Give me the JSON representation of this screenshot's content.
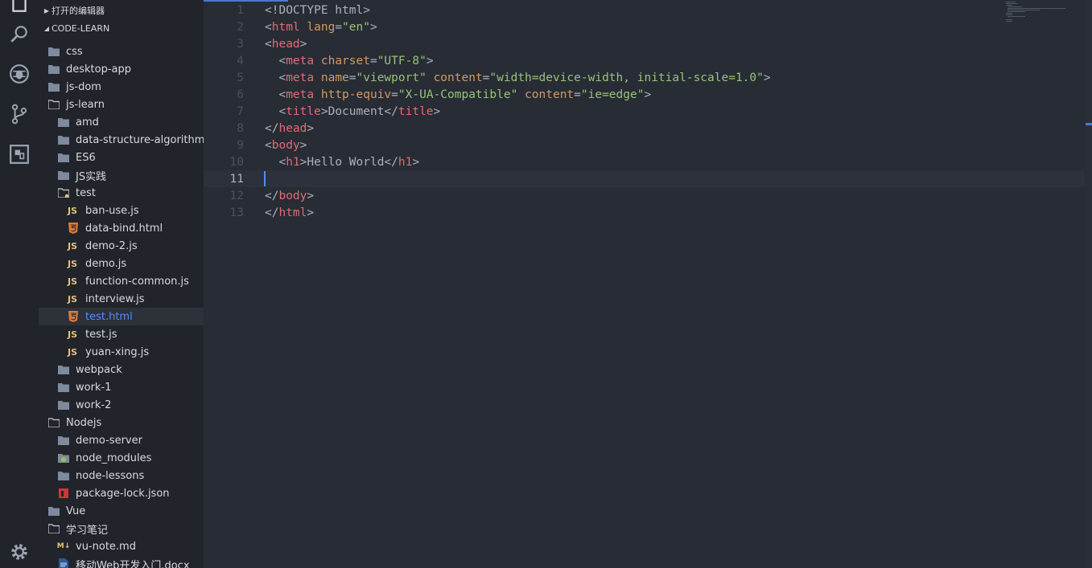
{
  "activity_bar": {
    "icons": [
      "explorer-icon",
      "search-icon",
      "debug-icon",
      "source-control-icon",
      "extensions-icon",
      "settings-gear-icon"
    ]
  },
  "sidebar": {
    "open_editors_label": "打开的编辑器",
    "project_label": "CODE-LEARN",
    "tree": [
      {
        "name": "css",
        "type": "folder",
        "depth": 0
      },
      {
        "name": "desktop-app",
        "type": "folder",
        "depth": 0
      },
      {
        "name": "js-dom",
        "type": "folder",
        "depth": 0
      },
      {
        "name": "js-learn",
        "type": "folder-open",
        "depth": 0
      },
      {
        "name": "amd",
        "type": "folder",
        "depth": 1
      },
      {
        "name": "data-structure-algorithm",
        "type": "folder",
        "depth": 1
      },
      {
        "name": "ES6",
        "type": "folder",
        "depth": 1
      },
      {
        "name": "JS实践",
        "type": "folder",
        "depth": 1
      },
      {
        "name": "test",
        "type": "folder-open",
        "depth": 1
      },
      {
        "name": "ban-use.js",
        "type": "js",
        "depth": 2
      },
      {
        "name": "data-bind.html",
        "type": "html",
        "depth": 2
      },
      {
        "name": "demo-2.js",
        "type": "js",
        "depth": 2
      },
      {
        "name": "demo.js",
        "type": "js",
        "depth": 2
      },
      {
        "name": "function-common.js",
        "type": "js",
        "depth": 2
      },
      {
        "name": "interview.js",
        "type": "js",
        "depth": 2
      },
      {
        "name": "test.html",
        "type": "html",
        "depth": 2,
        "selected": true
      },
      {
        "name": "test.js",
        "type": "js",
        "depth": 2
      },
      {
        "name": "yuan-xing.js",
        "type": "js",
        "depth": 2
      },
      {
        "name": "webpack",
        "type": "folder",
        "depth": 1
      },
      {
        "name": "work-1",
        "type": "folder",
        "depth": 1
      },
      {
        "name": "work-2",
        "type": "folder",
        "depth": 1
      },
      {
        "name": "Nodejs",
        "type": "folder-open",
        "depth": 0
      },
      {
        "name": "demo-server",
        "type": "folder",
        "depth": 1
      },
      {
        "name": "node_modules",
        "type": "folder-node",
        "depth": 1
      },
      {
        "name": "node-lessons",
        "type": "folder",
        "depth": 1
      },
      {
        "name": "package-lock.json",
        "type": "npm",
        "depth": 1
      },
      {
        "name": "Vue",
        "type": "folder",
        "depth": 0
      },
      {
        "name": "学习笔记",
        "type": "folder-open",
        "depth": 0
      },
      {
        "name": "vu-note.md",
        "type": "md",
        "depth": 1
      },
      {
        "name": "移动Web开发入门.docx",
        "type": "doc",
        "depth": 1
      }
    ]
  },
  "editor": {
    "current_line": 11,
    "lines": [
      [
        [
          "t-punc",
          "<!DOCTYPE html>"
        ]
      ],
      [
        [
          "t-punc",
          "<"
        ],
        [
          "t-tag",
          "html"
        ],
        [
          "t-punc",
          " "
        ],
        [
          "t-attr",
          "lang"
        ],
        [
          "t-punc",
          "="
        ],
        [
          "t-str",
          "\"en\""
        ],
        [
          "t-punc",
          ">"
        ]
      ],
      [
        [
          "t-punc",
          "<"
        ],
        [
          "t-tag",
          "head"
        ],
        [
          "t-punc",
          ">"
        ]
      ],
      [
        [
          "t-punc",
          "  <"
        ],
        [
          "t-tag",
          "meta"
        ],
        [
          "t-punc",
          " "
        ],
        [
          "t-attr",
          "charset"
        ],
        [
          "t-punc",
          "="
        ],
        [
          "t-str",
          "\"UTF-8\""
        ],
        [
          "t-punc",
          ">"
        ]
      ],
      [
        [
          "t-punc",
          "  <"
        ],
        [
          "t-tag",
          "meta"
        ],
        [
          "t-punc",
          " "
        ],
        [
          "t-attr",
          "name"
        ],
        [
          "t-punc",
          "="
        ],
        [
          "t-str",
          "\"viewport\""
        ],
        [
          "t-punc",
          " "
        ],
        [
          "t-attr",
          "content"
        ],
        [
          "t-punc",
          "="
        ],
        [
          "t-str",
          "\"width=device-width, initial-scale=1.0\""
        ],
        [
          "t-punc",
          ">"
        ]
      ],
      [
        [
          "t-punc",
          "  <"
        ],
        [
          "t-tag",
          "meta"
        ],
        [
          "t-punc",
          " "
        ],
        [
          "t-attr",
          "http-equiv"
        ],
        [
          "t-punc",
          "="
        ],
        [
          "t-str",
          "\"X-UA-Compatible\""
        ],
        [
          "t-punc",
          " "
        ],
        [
          "t-attr",
          "content"
        ],
        [
          "t-punc",
          "="
        ],
        [
          "t-str",
          "\"ie=edge\""
        ],
        [
          "t-punc",
          ">"
        ]
      ],
      [
        [
          "t-punc",
          "  <"
        ],
        [
          "t-tag",
          "title"
        ],
        [
          "t-punc",
          ">Document</"
        ],
        [
          "t-tag",
          "title"
        ],
        [
          "t-punc",
          ">"
        ]
      ],
      [
        [
          "t-punc",
          "</"
        ],
        [
          "t-tag",
          "head"
        ],
        [
          "t-punc",
          ">"
        ]
      ],
      [
        [
          "t-punc",
          "<"
        ],
        [
          "t-tag",
          "body"
        ],
        [
          "t-punc",
          ">"
        ]
      ],
      [
        [
          "t-punc",
          "  <"
        ],
        [
          "t-tag",
          "h1"
        ],
        [
          "t-punc",
          ">Hello World</"
        ],
        [
          "t-tag",
          "h1"
        ],
        [
          "t-punc",
          ">"
        ]
      ],
      [],
      [
        [
          "t-punc",
          "</"
        ],
        [
          "t-tag",
          "body"
        ],
        [
          "t-punc",
          ">"
        ]
      ],
      [
        [
          "t-punc",
          "</"
        ],
        [
          "t-tag",
          "html"
        ],
        [
          "t-punc",
          ">"
        ]
      ]
    ]
  },
  "colors": {
    "accent": "#4d78cc",
    "selected_text": "#4f8ff7",
    "tag": "#e06c75",
    "attribute": "#d19a66",
    "string": "#98c379"
  }
}
